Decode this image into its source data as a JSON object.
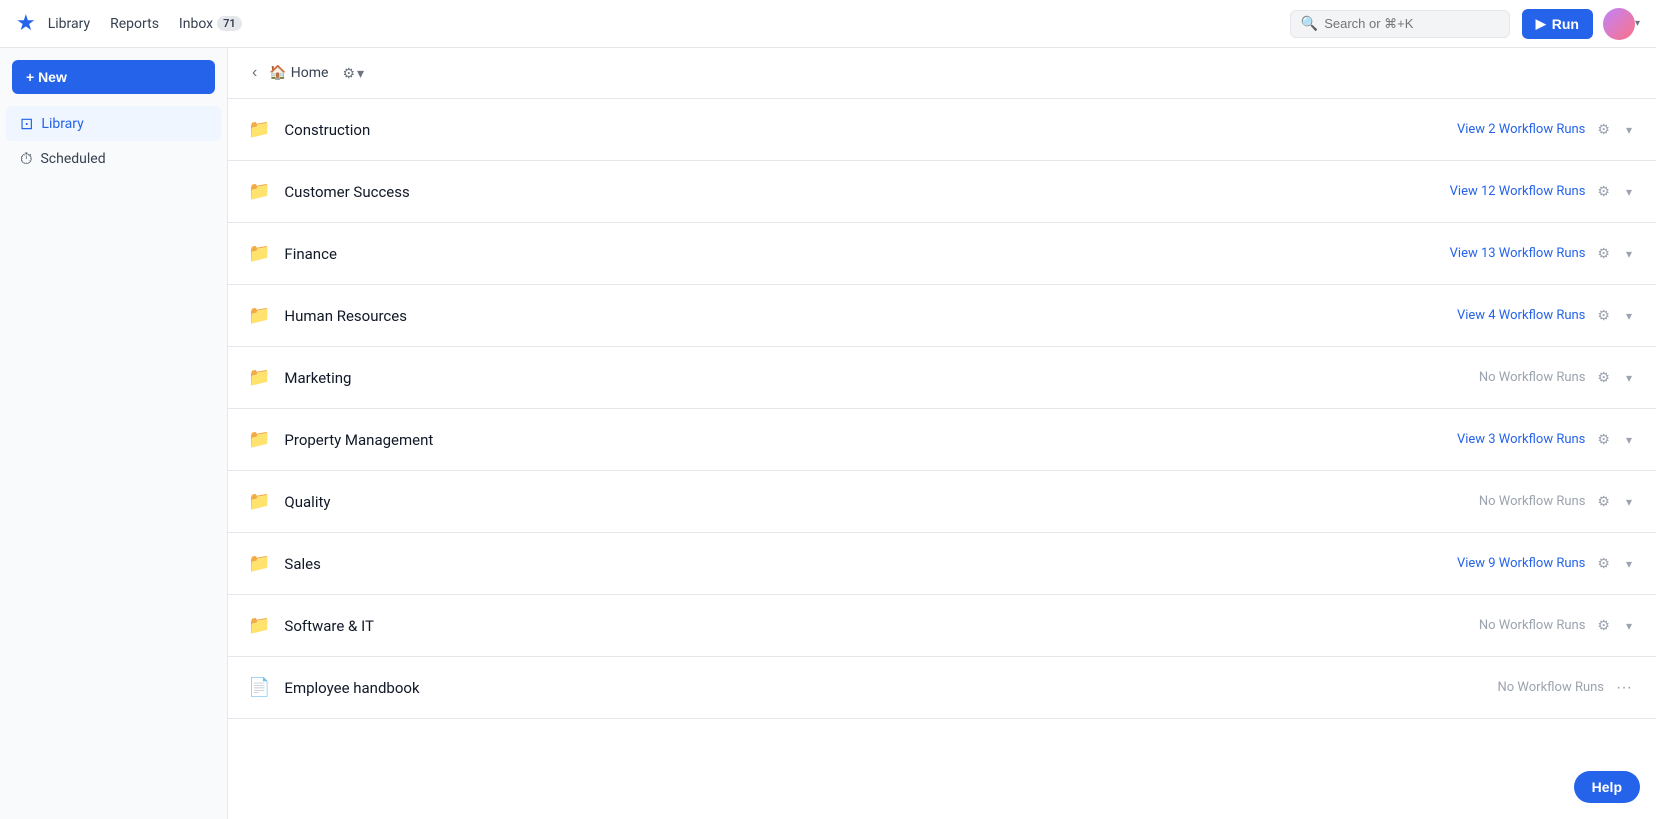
{
  "app": {
    "logo_icon": "★",
    "nav_links": [
      {
        "label": "Library",
        "id": "library"
      },
      {
        "label": "Reports",
        "id": "reports"
      }
    ],
    "inbox": {
      "label": "Inbox",
      "count": "71"
    },
    "search": {
      "placeholder": "Search or ⌘+K"
    },
    "run_button": "Run",
    "avatar_alt": "User avatar",
    "chevron": "▾"
  },
  "sidebar": {
    "new_button": "+ New",
    "items": [
      {
        "id": "library",
        "label": "Library",
        "icon": "⊡",
        "active": true
      },
      {
        "id": "scheduled",
        "label": "Scheduled",
        "icon": "⏱",
        "active": false
      }
    ]
  },
  "content_header": {
    "collapse_icon": "‹",
    "home_label": "Home",
    "settings_icon": "⚙",
    "settings_chevron": "▾"
  },
  "library_items": [
    {
      "id": "construction",
      "name": "Construction",
      "icon": "folder",
      "workflow_runs": "View 2 Workflow Runs",
      "has_runs": true,
      "doc": false
    },
    {
      "id": "customer-success",
      "name": "Customer Success",
      "icon": "folder",
      "workflow_runs": "View 12 Workflow Runs",
      "has_runs": true,
      "doc": false
    },
    {
      "id": "finance",
      "name": "Finance",
      "icon": "folder",
      "workflow_runs": "View 13 Workflow Runs",
      "has_runs": true,
      "doc": false
    },
    {
      "id": "human-resources",
      "name": "Human Resources",
      "icon": "folder",
      "workflow_runs": "View 4 Workflow Runs",
      "has_runs": true,
      "doc": false
    },
    {
      "id": "marketing",
      "name": "Marketing",
      "icon": "folder",
      "workflow_runs": "No Workflow Runs",
      "has_runs": false,
      "doc": false
    },
    {
      "id": "property-management",
      "name": "Property Management",
      "icon": "folder",
      "workflow_runs": "View 3 Workflow Runs",
      "has_runs": true,
      "doc": false
    },
    {
      "id": "quality",
      "name": "Quality",
      "icon": "folder",
      "workflow_runs": "No Workflow Runs",
      "has_runs": false,
      "doc": false
    },
    {
      "id": "sales",
      "name": "Sales",
      "icon": "folder",
      "workflow_runs": "View 9 Workflow Runs",
      "has_runs": true,
      "doc": false
    },
    {
      "id": "software-it",
      "name": "Software & IT",
      "icon": "folder",
      "workflow_runs": "No Workflow Runs",
      "has_runs": false,
      "doc": false
    },
    {
      "id": "employee-handbook",
      "name": "Employee handbook",
      "icon": "document",
      "workflow_runs": "No Workflow Runs",
      "has_runs": false,
      "doc": true
    }
  ],
  "help_button": "Help"
}
